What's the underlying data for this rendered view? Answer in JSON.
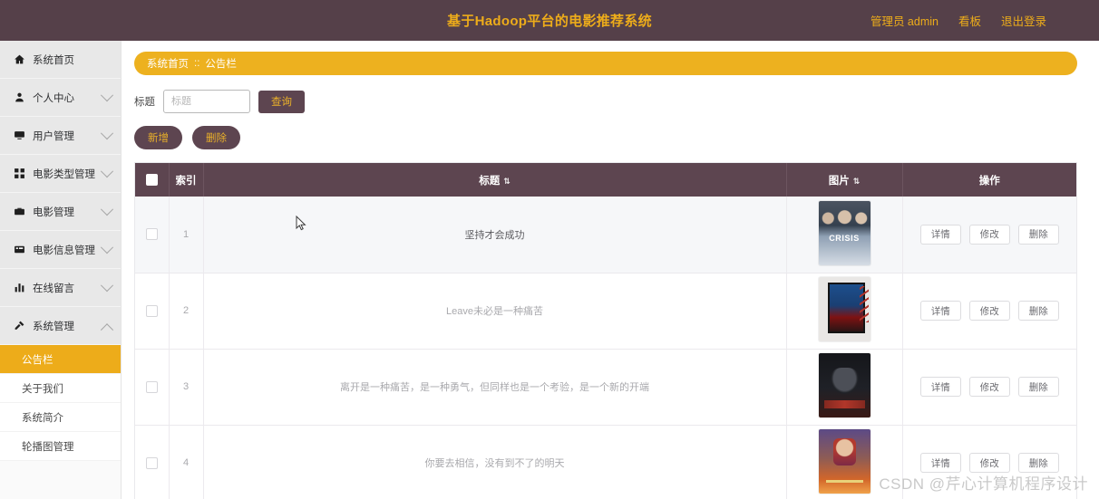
{
  "header": {
    "title": "基于Hadoop平台的电影推荐系统",
    "links": [
      {
        "label": "管理员 admin",
        "name": "admin-link"
      },
      {
        "label": "看板",
        "name": "dashboard-link"
      },
      {
        "label": "退出登录",
        "name": "logout-link"
      }
    ],
    "bg_color": "#554049",
    "text_color": "#edac1a"
  },
  "sidebar": {
    "items": [
      {
        "label": "系统首页",
        "icon": "home-icon",
        "expandable": false
      },
      {
        "label": "个人中心",
        "icon": "user-icon",
        "expandable": true
      },
      {
        "label": "用户管理",
        "icon": "monitor-icon",
        "expandable": true
      },
      {
        "label": "电影类型管理",
        "icon": "grid-icon",
        "expandable": true
      },
      {
        "label": "电影管理",
        "icon": "briefcase-icon",
        "expandable": true
      },
      {
        "label": "电影信息管理",
        "icon": "film-icon",
        "expandable": true
      },
      {
        "label": "在线留言",
        "icon": "chart-icon",
        "expandable": true
      },
      {
        "label": "系统管理",
        "icon": "tools-icon",
        "expandable": true,
        "expanded": true
      }
    ],
    "submenu": [
      {
        "label": "公告栏",
        "active": true
      },
      {
        "label": "关于我们",
        "active": false
      },
      {
        "label": "系统简介",
        "active": false
      },
      {
        "label": "轮播图管理",
        "active": false
      }
    ],
    "active_color": "#edac1a"
  },
  "breadcrumb": {
    "root": "系统首页",
    "separator": "::",
    "current": "公告栏"
  },
  "search": {
    "label": "标题",
    "placeholder": "标题",
    "value": "",
    "query_button": "查询"
  },
  "toolbar": {
    "add_label": "新增",
    "delete_label": "删除"
  },
  "table": {
    "columns": [
      {
        "key": "check",
        "label": "",
        "sortable": false
      },
      {
        "key": "index",
        "label": "索引",
        "sortable": false
      },
      {
        "key": "title",
        "label": "标题",
        "sortable": true
      },
      {
        "key": "image",
        "label": "图片",
        "sortable": true
      },
      {
        "key": "action",
        "label": "操作",
        "sortable": false
      }
    ],
    "sort_icon": "⇅",
    "rows": [
      {
        "index": "1",
        "title": "坚持才会成功",
        "poster": "crisis-poster"
      },
      {
        "index": "2",
        "title": "Leave未必是一种痛苦",
        "poster": "framed-poster"
      },
      {
        "index": "3",
        "title": "离开是一种痛苦，是一种勇气，但同样也是一个考验，是一个新的开端",
        "poster": "batman-poster"
      },
      {
        "index": "4",
        "title": "你要去相信，没有到不了的明天",
        "poster": "hero-poster"
      }
    ],
    "row_actions": [
      "详情",
      "修改",
      "删除"
    ],
    "header_bg": "#5d4550"
  },
  "watermark": "CSDN @芹心计算机程序设计"
}
